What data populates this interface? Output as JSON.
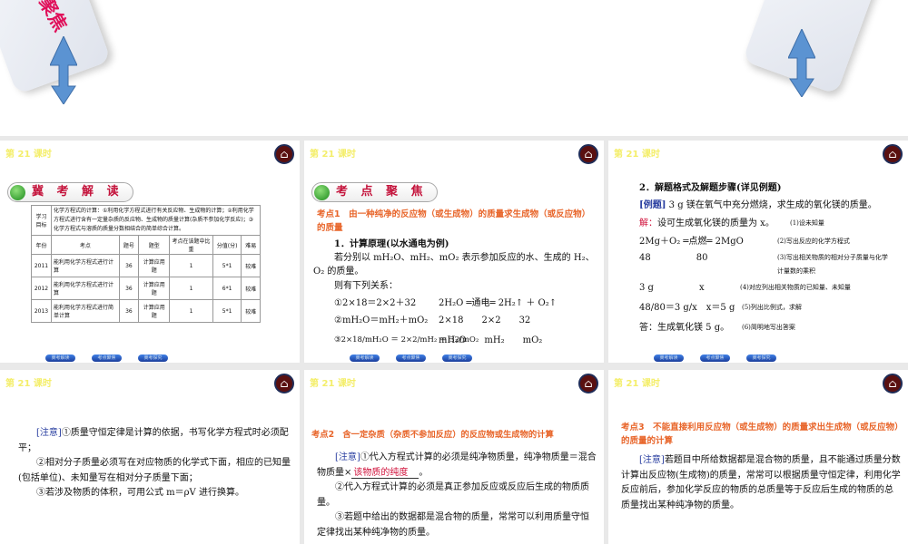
{
  "banner": {
    "partial_title": "聚焦"
  },
  "common": {
    "lesson": "第 21 课时",
    "home_icon": "home-icon",
    "nav": [
      "冀考解读",
      "考点聚焦",
      "冀考探究"
    ]
  },
  "slide1": {
    "heading": "冀 考 解 读",
    "goal_label": "学习目标",
    "goal_text": "化学方程式的计算：①利用化学方程式进行有关反应物、生成物的计算；②利用化学方程式进行含有一定量杂质的反应物、生成物的质量计算(杂质不参加化学反应)；③化学方程式与溶质的质量分数相结合的简单综合计算。",
    "headers": [
      "年份",
      "考点",
      "题号",
      "题型",
      "考点在该题中比重",
      "分值(分)",
      "难易"
    ],
    "rows": [
      [
        "2011",
        "能利用化学方程式进行计算",
        "36",
        "计算应用题",
        "1",
        "5*1",
        "较难"
      ],
      [
        "2012",
        "能利用化学方程式进行计算",
        "36",
        "计算应用题",
        "1",
        "6*1",
        "较难"
      ],
      [
        "2013",
        "能利用化学方程式进行简单计算",
        "36",
        "计算应用题",
        "1",
        "5*1",
        "较难"
      ]
    ]
  },
  "slide2": {
    "heading": "考 点 聚 焦",
    "point": "考点1　由一种纯净的反应物（或生成物）的质量求生成物（或反应物）的质量",
    "l1": "1．计算原理(以水通电为例)",
    "l2": "若分别以 mH₂O、mH₂、mO₂ 表示参加反应的水、生成的 H₂、O₂ 的质量。",
    "l3": "则有下列关系：",
    "e1a": "①2×18＝2×2＋32",
    "e1b": "2H₂O ═通电═ 2H₂↑ ＋ O₂↑",
    "e2a": "②mH₂O＝mH₂＋mO₂",
    "e2b": "2×18　　2×2　　32",
    "e3a": "③2×18/mH₂O ＝ 2×2/mH₂ ＝ 32/mO₂",
    "e3b": "mH₂O　　mH₂　　mO₂"
  },
  "slide3": {
    "l1": "2．解题格式及解题步骤(详见例题)",
    "ex_label": "[例题]",
    "ex": " 3 g 镁在氧气中充分燃烧，求生成的氧化镁的质量。",
    "sol_label": "解：",
    "sol": "设可生成氧化镁的质量为 x。",
    "s1": "(1)设未知量",
    "eq": "2Mg＋O₂ ═点燃═ 2MgO",
    "s2": "(2)写出反应的化学方程式",
    "m1": "48　　　　　80",
    "s3": "(3)写出相关物质的相对分子质量与化学计量数的乘积",
    "m2": "3 g　　　　　x",
    "s4": "(4)对应列出相关物质的已知量、未知量",
    "m3": "48/80＝3 g/x　x＝5 g",
    "s5": "(5)列出比例式，求解",
    "ans": "答：生成氧化镁 5 g。",
    "s6": "(6)简明地写出答案"
  },
  "slide4": {
    "note": "[注意]",
    "t1": "①质量守恒定律是计算的依据，书写化学方程式时必须配平；",
    "t2": "②相对分子质量必须写在对应物质的化学式下面，相应的已知量(包括单位)、未知量写在相对分子质量下面；",
    "t3": "③若涉及物质的体积，可用公式 m＝ρV 进行换算。"
  },
  "slide5": {
    "point": "考点2　含一定杂质（杂质不参加反应）的反应物或生成物的计算",
    "note": "[注意]",
    "t1a": "①代入方程式计算的必须是纯净物质量，纯净物质量＝混合物质量×",
    "blank": "该物质的纯度",
    "t1b": "。",
    "t2": "②代入方程式计算的必须是真正参加反应或反应后生成的物质质量。",
    "t3": "③若题中给出的数据都是混合物的质量，常常可以利用质量守恒定律找出某种纯净物的质量。"
  },
  "slide6": {
    "point": "考点3　不能直接利用反应物（或生成物）的质量求出生成物（或反应物）的质量的计算",
    "note": "[注意]",
    "t1": "若题目中所给数据都是混合物的质量，且不能通过质量分数计算出反应物(生成物)的质量，常常可以根据质量守恒定律，利用化学反应前后，参加化学反应的物质的总质量等于反应后生成的物质的总质量找出某种纯净物的质量。"
  },
  "colors": {
    "lesson": "#f4ee6a",
    "orange": "#e8652a",
    "heading": "#c4143c",
    "blue": "#2a3fa0"
  }
}
